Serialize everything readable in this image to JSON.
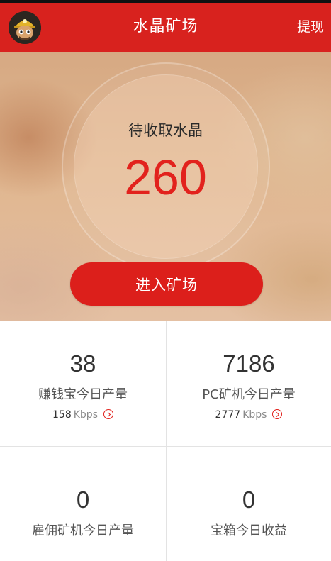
{
  "header": {
    "title": "水晶矿场",
    "withdraw_label": "提现"
  },
  "hero": {
    "pending_label": "待收取水晶",
    "pending_value": "260",
    "enter_button_label": "进入矿场"
  },
  "stats": [
    {
      "value": "38",
      "label": "赚钱宝今日产量",
      "rate": "158",
      "rate_unit": "Kbps"
    },
    {
      "value": "7186",
      "label": "PC矿机今日产量",
      "rate": "2777",
      "rate_unit": "Kbps"
    },
    {
      "value": "0",
      "label": "雇佣矿机今日产量"
    },
    {
      "value": "0",
      "label": "宝箱今日收益"
    }
  ],
  "colors": {
    "brand_red": "#d8221e",
    "value_red": "#e2221d"
  },
  "icons": {
    "avatar": "miner-avatar-icon",
    "rate_detail": "chevron-right-circle-icon"
  }
}
